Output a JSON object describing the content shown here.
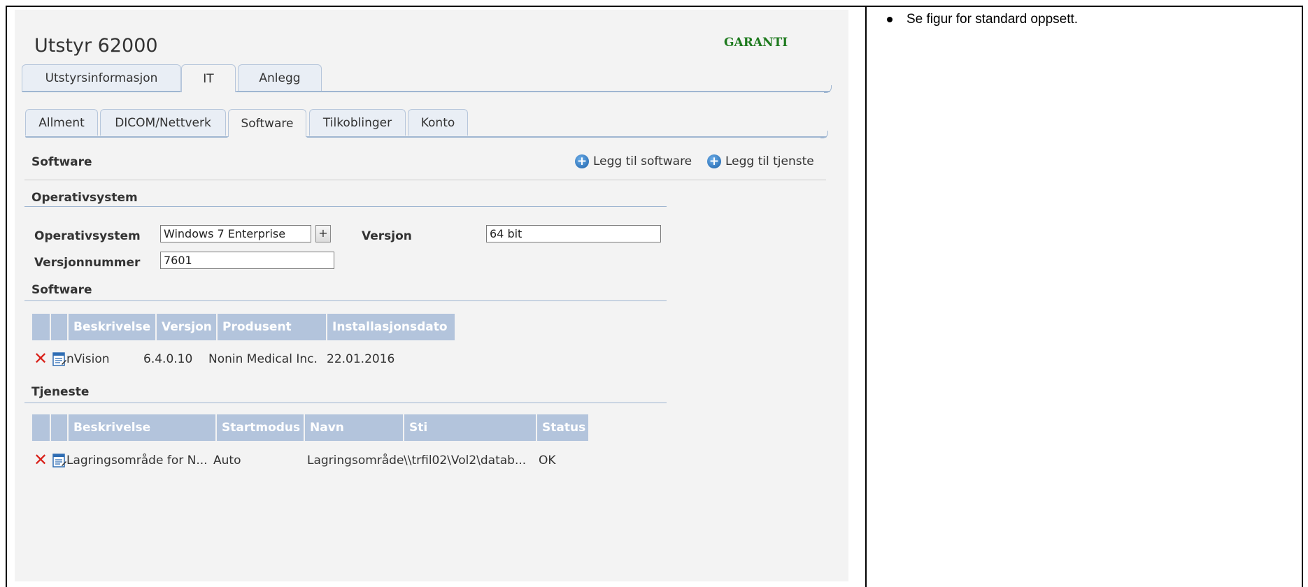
{
  "side_note": "Se figur for standard oppsett.",
  "header": {
    "title": "Utstyr 62000",
    "status": "GARANTI"
  },
  "main_tabs": [
    {
      "label": "Utstyrsinformasjon"
    },
    {
      "label": "IT"
    },
    {
      "label": "Anlegg"
    }
  ],
  "sub_tabs": [
    {
      "label": "Allment"
    },
    {
      "label": "DICOM/Nettverk"
    },
    {
      "label": "Software"
    },
    {
      "label": "Tilkoblinger"
    },
    {
      "label": "Konto"
    }
  ],
  "software_section": {
    "title": "Software",
    "add_software": "Legg til software",
    "add_service": "Legg til tjenste"
  },
  "os": {
    "heading": "Operativsystem",
    "os_label": "Operativsystem",
    "os_value": "Windows 7 Enterprise",
    "add_symbol": "+",
    "version_label": "Versjon",
    "version_value": "64 bit",
    "build_label": "Versjonnummer",
    "build_value": "7601"
  },
  "software_table": {
    "heading": "Software",
    "columns": [
      "Beskrivelse",
      "Versjon",
      "Produsent",
      "Installasjonsdato"
    ],
    "rows": [
      {
        "beskrivelse": "nVision",
        "versjon": "6.4.0.10",
        "produsent": "Nonin Medical Inc.",
        "dato": "22.01.2016"
      }
    ]
  },
  "service_table": {
    "heading": "Tjeneste",
    "columns": [
      "Beskrivelse",
      "Startmodus",
      "Navn",
      "Sti",
      "Status"
    ],
    "rows": [
      {
        "beskrivelse": "Lagringsområde for N...",
        "startmodus": "Auto",
        "navn": "Lagringsområde",
        "sti": "\\\\trfil02\\Vol2\\datab...",
        "status": "OK"
      }
    ]
  },
  "icons": {
    "delete": "delete-x-icon",
    "edit": "edit-document-icon",
    "add": "add-circle-icon"
  },
  "colors": {
    "status_green": "#1e7a1e",
    "table_header": "#b3c4dc",
    "delete_red": "#d9231c"
  }
}
